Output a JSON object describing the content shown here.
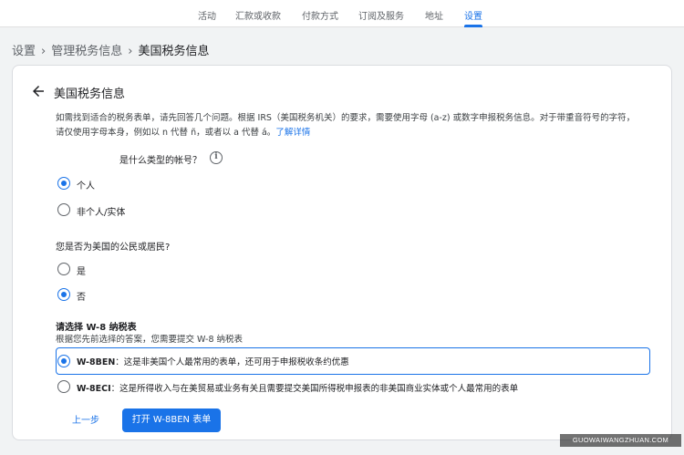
{
  "topnav": {
    "tabs": [
      "活动",
      "汇款或收款",
      "付款方式",
      "订阅及服务",
      "地址",
      "设置"
    ],
    "active_index": 5
  },
  "breadcrumb": [
    "设置",
    "管理税务信息",
    "美国税务信息"
  ],
  "card": {
    "title": "美国税务信息",
    "intro": "如需找到适合的税务表单，请先回答几个问题。根据 IRS（美国税务机关）的要求，需要使用字母 (a-z) 或数字申报税务信息。对于带重音符号的字符，请仅使用字母本身，例如以 n 代替 ñ，或者以 a 代替 á。",
    "learn_more": "了解详情",
    "q1": {
      "text": "是什么类型的帐号？",
      "options": [
        "个人",
        "非个人/实体"
      ],
      "selected": 0
    },
    "q2": {
      "text": "您是否为美国的公民或居民?",
      "options": [
        "是",
        "否"
      ],
      "selected": 1
    },
    "w8": {
      "title": "请选择 W-8 纳税表",
      "subtitle": "根据您先前选择的答案，您需要提交 W-8 纳税表",
      "options": [
        {
          "name": "W-8BEN",
          "desc": "：这是非美国个人最常用的表单，还可用于申报税收条约优惠"
        },
        {
          "name": "W-8ECI",
          "desc": "：这是所得收入与在美贸易或业务有关且需要提交美国所得税申报表的非美国商业实体或个人最常用的表单"
        }
      ],
      "selected": 0
    },
    "buttons": {
      "prev": "上一步",
      "open": "打开 W-8BEN 表单"
    }
  },
  "watermark": "GUOWAIWANGZHUAN.COM",
  "colors": {
    "accent": "#1a73e8",
    "background": "#f1f3f4"
  },
  "icons": {
    "back": "arrow-left-icon",
    "info": "info-icon"
  }
}
